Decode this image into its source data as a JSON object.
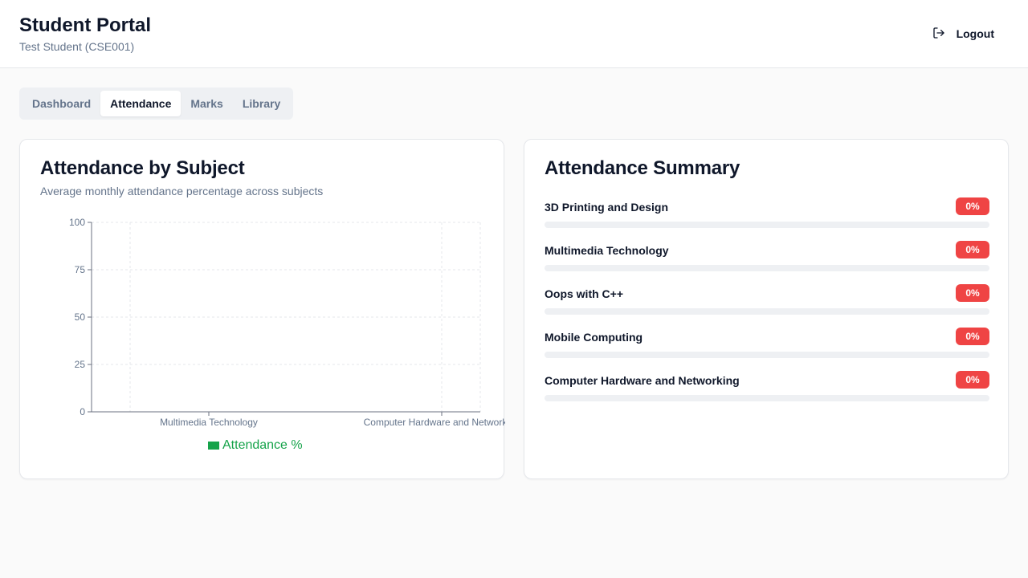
{
  "header": {
    "title": "Student Portal",
    "subtitle": "Test Student (CSE001)",
    "logout_label": "Logout",
    "logout_icon": "logout-icon"
  },
  "tabs": [
    {
      "label": "Dashboard",
      "active": false
    },
    {
      "label": "Attendance",
      "active": true
    },
    {
      "label": "Marks",
      "active": false
    },
    {
      "label": "Library",
      "active": false
    }
  ],
  "attendance_chart": {
    "title": "Attendance by Subject",
    "description": "Average monthly attendance percentage across subjects",
    "legend_label": "Attendance %"
  },
  "chart_data": {
    "type": "bar",
    "categories": [
      "Multimedia Technology",
      "Computer Hardware and Networking"
    ],
    "series": [
      {
        "name": "Attendance %",
        "values": [
          0,
          0
        ],
        "color": "#16a34a"
      }
    ],
    "ylim": [
      0,
      100
    ],
    "yticks": [
      0,
      25,
      50,
      75,
      100
    ],
    "grid": true,
    "legend_position": "bottom"
  },
  "summary": {
    "title": "Attendance Summary",
    "items": [
      {
        "name": "3D Printing and Design",
        "percent_label": "0%",
        "percent": 0
      },
      {
        "name": "Multimedia Technology",
        "percent_label": "0%",
        "percent": 0
      },
      {
        "name": "Oops with C++",
        "percent_label": "0%",
        "percent": 0
      },
      {
        "name": "Mobile Computing",
        "percent_label": "0%",
        "percent": 0
      },
      {
        "name": "Computer Hardware and Networking",
        "percent_label": "0%",
        "percent": 0
      }
    ]
  },
  "colors": {
    "accent_green": "#16a34a",
    "badge_red": "#ef4444"
  }
}
